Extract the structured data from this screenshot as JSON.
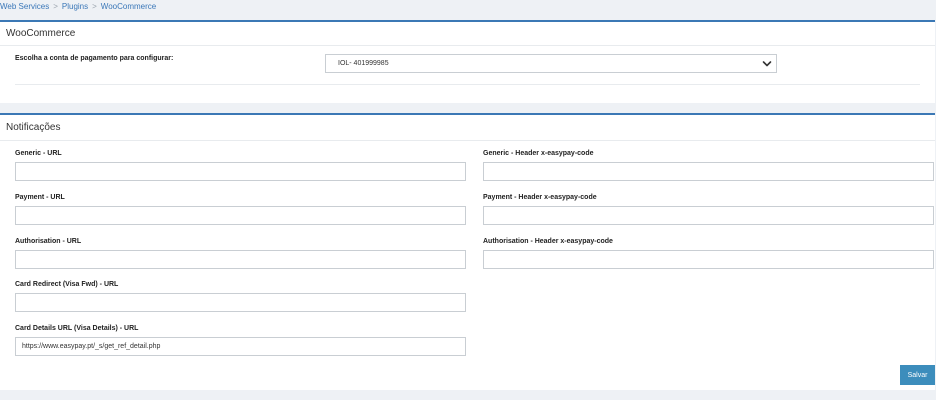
{
  "breadcrumb": {
    "items": [
      "Web Services",
      "Plugins",
      "WooCommerce"
    ],
    "separator": ">"
  },
  "woocommerce": {
    "title": "WooCommerce",
    "account_label": "Escolha a conta de pagamento para configurar:",
    "account_value": "IOL- 401999985"
  },
  "notifications": {
    "title": "Notificações",
    "generic_url_label": "Generic - URL",
    "generic_url_value": "",
    "generic_header_label": "Generic - Header x-easypay-code",
    "generic_header_value": "",
    "payment_url_label": "Payment - URL",
    "payment_url_value": "",
    "payment_header_label": "Payment - Header x-easypay-code",
    "payment_header_value": "",
    "authorisation_url_label": "Authorisation - URL",
    "authorisation_url_value": "",
    "authorisation_header_label": "Authorisation - Header x-easypay-code",
    "authorisation_header_value": "",
    "card_redirect_label": "Card Redirect (Visa Fwd) - URL",
    "card_redirect_value": "",
    "card_details_label": "Card Details URL (Visa Details) - URL",
    "card_details_value": "https://www.easypay.pt/_s/get_ref_detail.php",
    "save_label": "Salvar"
  },
  "colors": {
    "accent": "#3b78b5",
    "button": "#3c8dbc",
    "link": "#3a77b8",
    "background": "#eef1f5"
  }
}
